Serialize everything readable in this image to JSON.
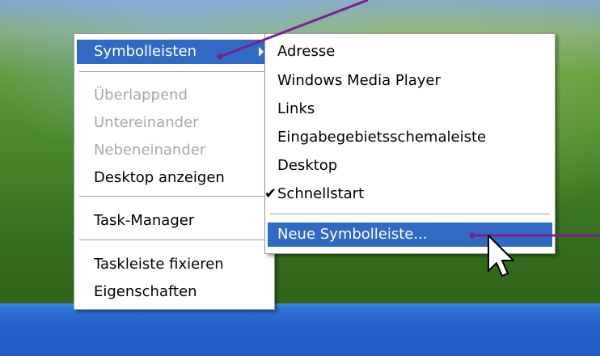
{
  "context_menu": {
    "items": [
      {
        "label": "Symbolleisten",
        "state": "highlighted",
        "has_submenu": true
      },
      {
        "label": "Überlappend",
        "state": "disabled"
      },
      {
        "label": "Untereinander",
        "state": "disabled"
      },
      {
        "label": "Nebeneinander",
        "state": "disabled"
      },
      {
        "label": "Desktop anzeigen",
        "state": "enabled"
      },
      {
        "label": "Task-Manager",
        "state": "enabled"
      },
      {
        "label": "Taskleiste fixieren",
        "state": "enabled"
      },
      {
        "label": "Eigenschaften",
        "state": "enabled"
      }
    ]
  },
  "submenu": {
    "items": [
      {
        "label": "Adresse",
        "checked": false
      },
      {
        "label": "Windows Media Player",
        "checked": false
      },
      {
        "label": "Links",
        "checked": false
      },
      {
        "label": "Eingabegebietsschemaleiste",
        "checked": false
      },
      {
        "label": "Desktop",
        "checked": false
      },
      {
        "label": "Schnellstart",
        "checked": true
      },
      {
        "label": "Neue Symbolleiste...",
        "checked": false,
        "state": "highlighted"
      }
    ]
  },
  "icons": {
    "submenu_arrow": "triangle-right-icon",
    "check": "check-mark-icon",
    "cursor": "arrow-cursor-icon"
  },
  "colors": {
    "highlight": "#316ac5",
    "disabled_text": "#a8a8a8",
    "annotation_line": "#7a1f8c",
    "taskbar": "#245bc3"
  }
}
